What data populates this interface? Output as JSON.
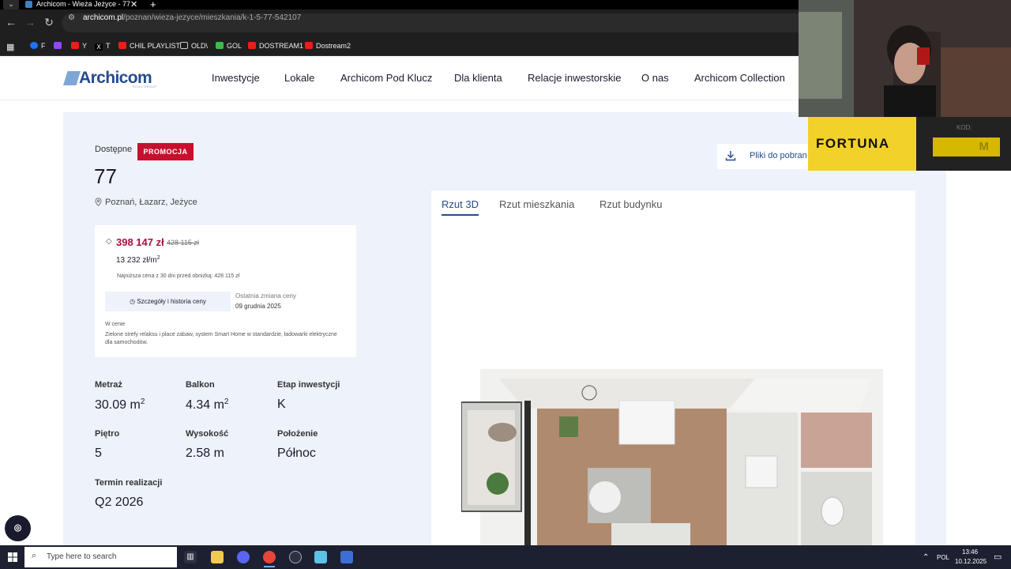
{
  "browser": {
    "tab_title": "Archicom - Wieża Jeżyce - 77",
    "url_host": "archicom.pl",
    "url_path": "/poznan/wieza-jezyce/mieszkania/k-1-5-77-542107",
    "bookmarks": [
      "F",
      "Y",
      "T",
      "CHIL PLAYLIST",
      "OLD\\",
      "GOL",
      "DOSTREAM1",
      "Dostream2"
    ]
  },
  "site": {
    "brand": "Archicom",
    "brand_sub": "ECHO GROUP",
    "menu": [
      "Inwestycje",
      "Lokale",
      "Archicom Pod Klucz",
      "Dla klienta",
      "Relacje inwestorskie",
      "O nas",
      "Archicom Collection"
    ]
  },
  "listing": {
    "status": "Dostępne",
    "badge": "PROMOCJA",
    "number": "77",
    "location": "Poznań, Łazarz, Jeżyce",
    "download_label": "Pliki do pobran",
    "price": {
      "current": "398 147 zł",
      "old": "428 115 zł",
      "per_m2": "13 232 zł/m",
      "per_m2_sup": "2",
      "lowest_note": "Najniższa cena z 30 dni przed obniżką: 428 115 zł",
      "history_button": "Szczegóły i historia ceny",
      "last_change_label": "Ostatnia zmiana ceny",
      "last_change_date": "09 grudnia 2025",
      "included_label": "W cenie",
      "included_text": "Zielone strefy relaksu i place zabaw, system Smart Home w standardzie, ładowarki elektryczne dla samochodów."
    },
    "specs": {
      "area": {
        "label": "Metraż",
        "value": "30.09 m",
        "sup": "2"
      },
      "balcony": {
        "label": "Balkon",
        "value": "4.34 m",
        "sup": "2"
      },
      "stage": {
        "label": "Etap inwestycji",
        "value": "K"
      },
      "floor": {
        "label": "Piętro",
        "value": "5"
      },
      "height": {
        "label": "Wysokość",
        "value": "2.58 m"
      },
      "orientation": {
        "label": "Położenie",
        "value": "Północ"
      },
      "completion": {
        "label": "Termin realizacji",
        "value": "Q2 2026"
      }
    },
    "plan_tabs": [
      "Rzut 3D",
      "Rzut mieszkania",
      "Rzut budynku"
    ]
  },
  "overlay": {
    "sponsor": "FORTUNA",
    "code_label": "KOD:",
    "code_value": "M"
  },
  "taskbar": {
    "search_placeholder": "Type here to search",
    "lang": "POL",
    "time": "13:46",
    "date": "10.12.2025"
  },
  "colors": {
    "brand_blue": "#244b8f",
    "promo_red": "#c8102e",
    "price_red": "#a3123a",
    "panel_bg": "#eef2fa"
  }
}
